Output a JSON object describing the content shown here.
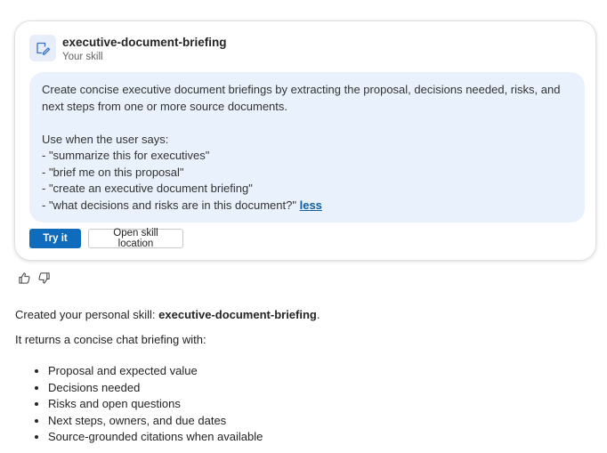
{
  "skill_card": {
    "icon": "document-edit-icon",
    "name": "executive-document-briefing",
    "subtitle": "Your skill",
    "description_line": "Create concise executive document briefings by extracting the proposal, decisions needed, risks, and next steps from one or more source documents.",
    "use_when_heading": "Use when the user says:",
    "triggers": [
      "- \"summarize this for executives\"",
      "- \"brief me on this proposal\"",
      "- \"create an executive document briefing\"",
      "- \"what decisions and risks are in this document?\""
    ],
    "less_link": "less",
    "try_button": "Try it",
    "open_location_button": "Open skill location"
  },
  "feedback": {
    "thumbs_up_icon": "thumbs-up-icon",
    "thumbs_down_icon": "thumbs-down-icon"
  },
  "message": {
    "created_prefix": "Created your personal skill:",
    "created_skill": "executive-document-briefing",
    "created_suffix": ".",
    "returns_text": "It returns a concise chat briefing with:",
    "items": [
      "Proposal and expected value",
      "Decisions needed",
      "Risks and open questions",
      "Next steps, owners, and due dates",
      "Source-grounded citations when available"
    ]
  },
  "colors": {
    "accent": "#0f6cbd",
    "description_bg": "#e9f1fc",
    "link": "#115ea3"
  }
}
